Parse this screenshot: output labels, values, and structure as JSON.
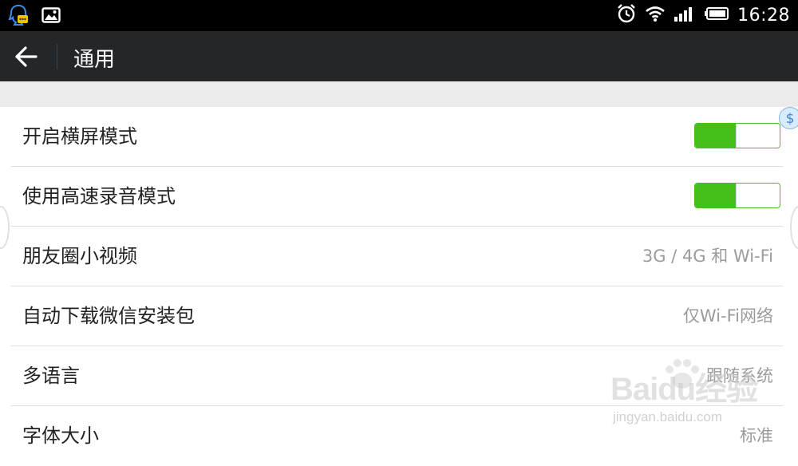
{
  "status_bar": {
    "time": "16:28",
    "icons": [
      "qq-icon",
      "image-icon",
      "alarm-icon",
      "wifi-icon",
      "signal-icon",
      "battery-icon"
    ]
  },
  "action_bar": {
    "title": "通用",
    "back_icon": "arrow-left-icon"
  },
  "settings": {
    "items": [
      {
        "label": "开启横屏模式",
        "type": "toggle",
        "on": true
      },
      {
        "label": "使用高速录音模式",
        "type": "toggle",
        "on": true
      },
      {
        "label": "朋友圈小视频",
        "type": "value",
        "value": "3G / 4G 和 Wi-Fi"
      },
      {
        "label": "自动下载微信安装包",
        "type": "value",
        "value": "仅Wi-Fi网络"
      },
      {
        "label": "多语言",
        "type": "value",
        "value": "跟随系统"
      },
      {
        "label": "字体大小",
        "type": "value",
        "value": "标准"
      }
    ]
  },
  "floating": {
    "dollar_symbol": "$"
  },
  "watermark": {
    "brand": "Baidu经验",
    "url": "jingyan.baidu.com"
  },
  "colors": {
    "status_bar_bg": "#000000",
    "action_bar_bg": "#23272a",
    "toggle_accent": "#45c01a",
    "value_text": "#9b9b9b",
    "label_text": "#222222"
  }
}
